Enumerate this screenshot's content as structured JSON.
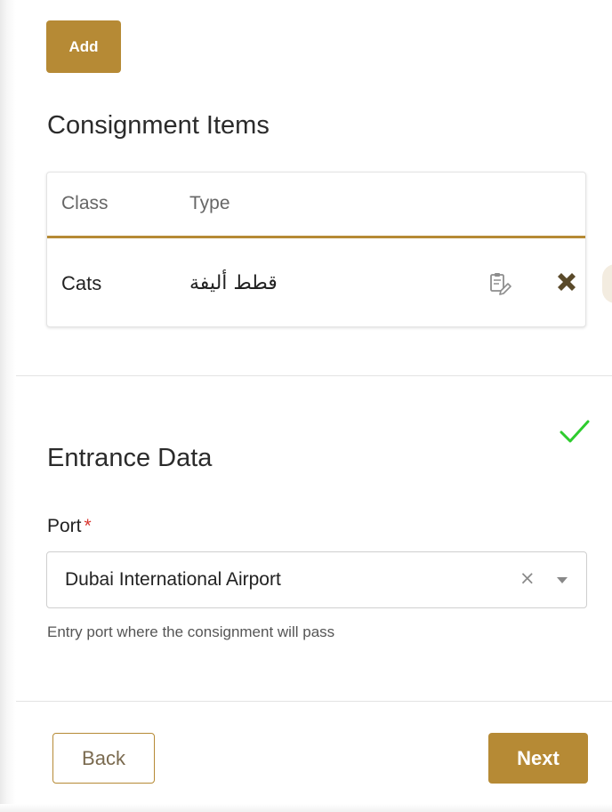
{
  "actions": {
    "add_label": "Add"
  },
  "consignment_items": {
    "title": "Consignment Items",
    "columns": [
      "Class",
      "Type"
    ],
    "rows": [
      {
        "class": "Cats",
        "type": "قطط أليفة",
        "actions": [
          "edit-icon",
          "delete-icon"
        ]
      }
    ]
  },
  "entrance_data": {
    "title": "Entrance Data",
    "status_icon": "check-icon",
    "port": {
      "label": "Port",
      "required_marker": "*",
      "value": "Dubai International Airport",
      "clear_symbol": "×",
      "help_text": "Entry port where the consignment will pass"
    }
  },
  "navigation": {
    "back_label": "Back",
    "next_label": "Next"
  },
  "colors": {
    "accent": "#b68a35",
    "success": "#2ecc2e",
    "required": "#d83731",
    "delete": "#5a4a2a"
  }
}
